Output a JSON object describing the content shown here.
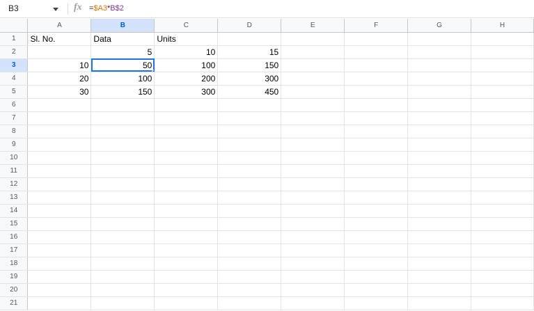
{
  "name_box": {
    "value": "B3"
  },
  "formula_bar": {
    "icon": "fx-icon",
    "icon_label": "fx",
    "formula_parts": [
      "=",
      "$A3",
      "*",
      "B$2"
    ]
  },
  "selection": {
    "column": "B",
    "row": "3"
  },
  "accent_color": "#1a73e8",
  "columns": [
    "A",
    "B",
    "C",
    "D",
    "E",
    "F",
    "G",
    "H"
  ],
  "rows": [
    {
      "label": "1",
      "cells": [
        "Sl. No.",
        "Data",
        "Units",
        "",
        "",
        "",
        "",
        ""
      ]
    },
    {
      "label": "2",
      "cells": [
        "",
        "5",
        "10",
        "15",
        "",
        "",
        "",
        ""
      ]
    },
    {
      "label": "3",
      "cells": [
        "10",
        "50",
        "100",
        "150",
        "",
        "",
        "",
        ""
      ]
    },
    {
      "label": "4",
      "cells": [
        "20",
        "100",
        "200",
        "300",
        "",
        "",
        "",
        ""
      ]
    },
    {
      "label": "5",
      "cells": [
        "30",
        "150",
        "300",
        "450",
        "",
        "",
        "",
        ""
      ]
    },
    {
      "label": "6",
      "cells": [
        "",
        "",
        "",
        "",
        "",
        "",
        "",
        ""
      ]
    },
    {
      "label": "7",
      "cells": [
        "",
        "",
        "",
        "",
        "",
        "",
        "",
        ""
      ]
    },
    {
      "label": "8",
      "cells": [
        "",
        "",
        "",
        "",
        "",
        "",
        "",
        ""
      ]
    },
    {
      "label": "9",
      "cells": [
        "",
        "",
        "",
        "",
        "",
        "",
        "",
        ""
      ]
    },
    {
      "label": "10",
      "cells": [
        "",
        "",
        "",
        "",
        "",
        "",
        "",
        ""
      ]
    },
    {
      "label": "11",
      "cells": [
        "",
        "",
        "",
        "",
        "",
        "",
        "",
        ""
      ]
    },
    {
      "label": "12",
      "cells": [
        "",
        "",
        "",
        "",
        "",
        "",
        "",
        ""
      ]
    },
    {
      "label": "13",
      "cells": [
        "",
        "",
        "",
        "",
        "",
        "",
        "",
        ""
      ]
    },
    {
      "label": "14",
      "cells": [
        "",
        "",
        "",
        "",
        "",
        "",
        "",
        ""
      ]
    },
    {
      "label": "15",
      "cells": [
        "",
        "",
        "",
        "",
        "",
        "",
        "",
        ""
      ]
    },
    {
      "label": "16",
      "cells": [
        "",
        "",
        "",
        "",
        "",
        "",
        "",
        ""
      ]
    },
    {
      "label": "17",
      "cells": [
        "",
        "",
        "",
        "",
        "",
        "",
        "",
        ""
      ]
    },
    {
      "label": "18",
      "cells": [
        "",
        "",
        "",
        "",
        "",
        "",
        "",
        ""
      ]
    },
    {
      "label": "19",
      "cells": [
        "",
        "",
        "",
        "",
        "",
        "",
        "",
        ""
      ]
    },
    {
      "label": "20",
      "cells": [
        "",
        "",
        "",
        "",
        "",
        "",
        "",
        ""
      ]
    },
    {
      "label": "21",
      "cells": [
        "",
        "",
        "",
        "",
        "",
        "",
        "",
        ""
      ]
    }
  ]
}
